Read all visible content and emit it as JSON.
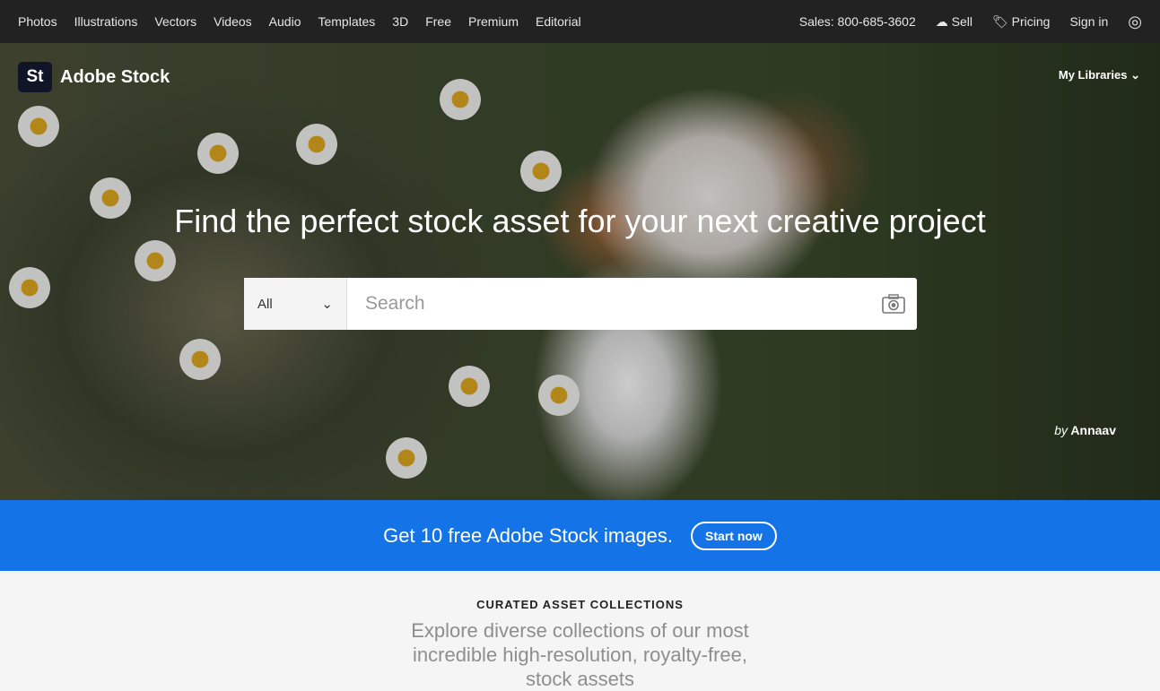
{
  "topnav": {
    "links": [
      "Photos",
      "Illustrations",
      "Vectors",
      "Videos",
      "Audio",
      "Templates",
      "3D",
      "Free",
      "Premium",
      "Editorial"
    ],
    "sales": "Sales: 800-685-3602",
    "sell": "Sell",
    "pricing": "Pricing",
    "signin": "Sign in"
  },
  "logo": {
    "badge": "St",
    "name": "Adobe Stock"
  },
  "my_libraries": "My Libraries",
  "hero": {
    "title": "Find the perfect stock asset for your next creative project",
    "credit_by": "by",
    "credit_name": "Annaav"
  },
  "search": {
    "category": "All",
    "placeholder": "Search"
  },
  "promo": {
    "text": "Get 10 free Adobe Stock images.",
    "button": "Start now"
  },
  "curated": {
    "kicker": "CURATED ASSET COLLECTIONS",
    "description": "Explore diverse collections of our most incredible high-resolution, royalty-free, stock assets"
  },
  "colors": {
    "accent": "#1473e6",
    "nav": "#222222"
  }
}
